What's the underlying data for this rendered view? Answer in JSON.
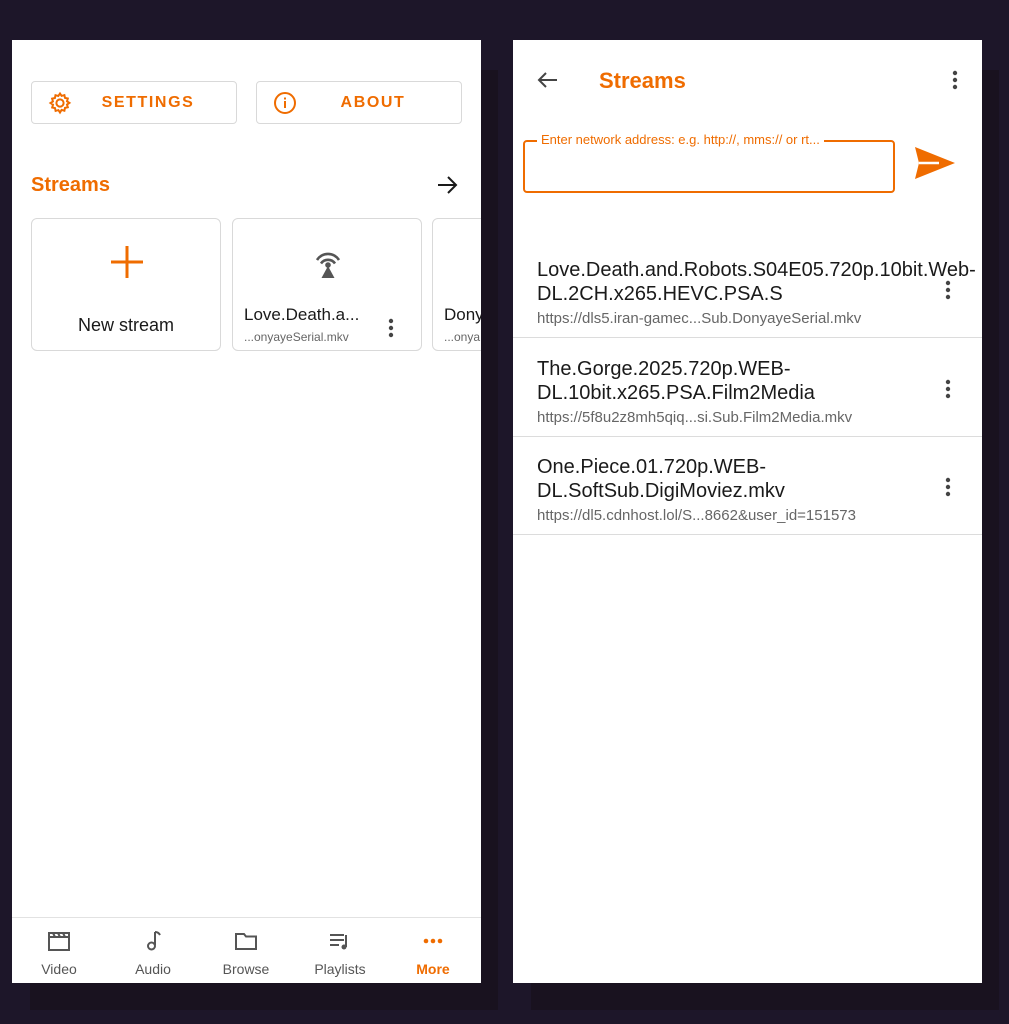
{
  "left_screen": {
    "top_buttons": {
      "settings_label": "SETTINGS",
      "about_label": "ABOUT"
    },
    "section_title": "Streams",
    "cards": {
      "new_stream_label": "New stream",
      "stream1_title": "Love.Death.a...",
      "stream1_subtitle": "...onyayeSerial.mkv",
      "stream2_title": "Dony",
      "stream2_subtitle": "...onya"
    },
    "bottom_nav": [
      {
        "label": "Video",
        "icon": "video-clapper-icon"
      },
      {
        "label": "Audio",
        "icon": "music-note-icon"
      },
      {
        "label": "Browse",
        "icon": "folder-icon"
      },
      {
        "label": "Playlists",
        "icon": "playlist-icon"
      },
      {
        "label": "More",
        "icon": "more-dots-icon",
        "active": true
      }
    ]
  },
  "right_screen": {
    "title": "Streams",
    "input_placeholder": "Enter network address: e.g. http://, mms:// or rt...",
    "items": [
      {
        "title": "Love.Death.and.Robots.S04E05.720p.10bit.Web-DL.2CH.x265.HEVC.PSA.S",
        "url": "https://dls5.iran-gamec...Sub.DonyayeSerial.mkv"
      },
      {
        "title": "The.Gorge.2025.720p.WEB-DL.10bit.x265.PSA.Film2Media",
        "url": "https://5f8u2z8mh5qiq...si.Sub.Film2Media.mkv"
      },
      {
        "title": "One.Piece.01.720p.WEB-DL.SoftSub.DigiMoviez.mkv",
        "url": "https://dl5.cdnhost.lol/S...8662&user_id=151573"
      }
    ]
  },
  "colors": {
    "accent": "#ef6c00",
    "background": "#1d1629",
    "text": "#1a1a1a",
    "secondary_text": "#666666"
  }
}
